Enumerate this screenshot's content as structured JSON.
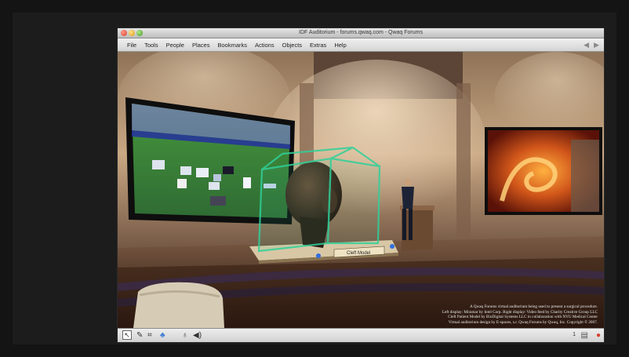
{
  "window": {
    "title": "IDF Auditorium - forums.qwaq.com - Qwaq Forums"
  },
  "menu": {
    "items": [
      "File",
      "Tools",
      "People",
      "Places",
      "Bookmarks",
      "Actions",
      "Objects",
      "Extras",
      "Help"
    ],
    "back_icon": "triangle-left-icon",
    "forward_icon": "triangle-right-icon"
  },
  "scene": {
    "plaque_label": "Cleft Model",
    "caption_lines": [
      "A Qwaq Forums virtual auditorium being used to present a surgical procedure.",
      "Left display: Miramar by Intel Corp. Right display: Video feed by Charity Creative Group LLC",
      "Cleft Patient Model by BioDigital Systems LLC in collaboration with NYU Medical Center",
      "Virtual auditorium design by E-spaces, s.r. Qwaq Forums by Qwaq, Inc. Copyright © 2007."
    ]
  },
  "toolbar": {
    "tools": [
      {
        "name": "pointer-tool-icon",
        "glyph": "↖",
        "selected": true
      },
      {
        "name": "pen-tool-icon",
        "glyph": "✎"
      },
      {
        "name": "crop-tool-icon",
        "glyph": "⌗"
      },
      {
        "name": "shapes-tool-icon",
        "glyph": "♣"
      },
      {
        "name": "avatar-tool-icon",
        "glyph": "♁"
      },
      {
        "name": "speaker-icon",
        "glyph": "◀)"
      }
    ],
    "user_count": "1",
    "notes_icon": "document-icon",
    "app_icon": "qwaq-logo-icon"
  },
  "colors": {
    "menubar": "#d8d8d8",
    "cube_edge": "#2fd19a",
    "screen_grass": "#3f8a3a",
    "wall": "#c9a883"
  }
}
